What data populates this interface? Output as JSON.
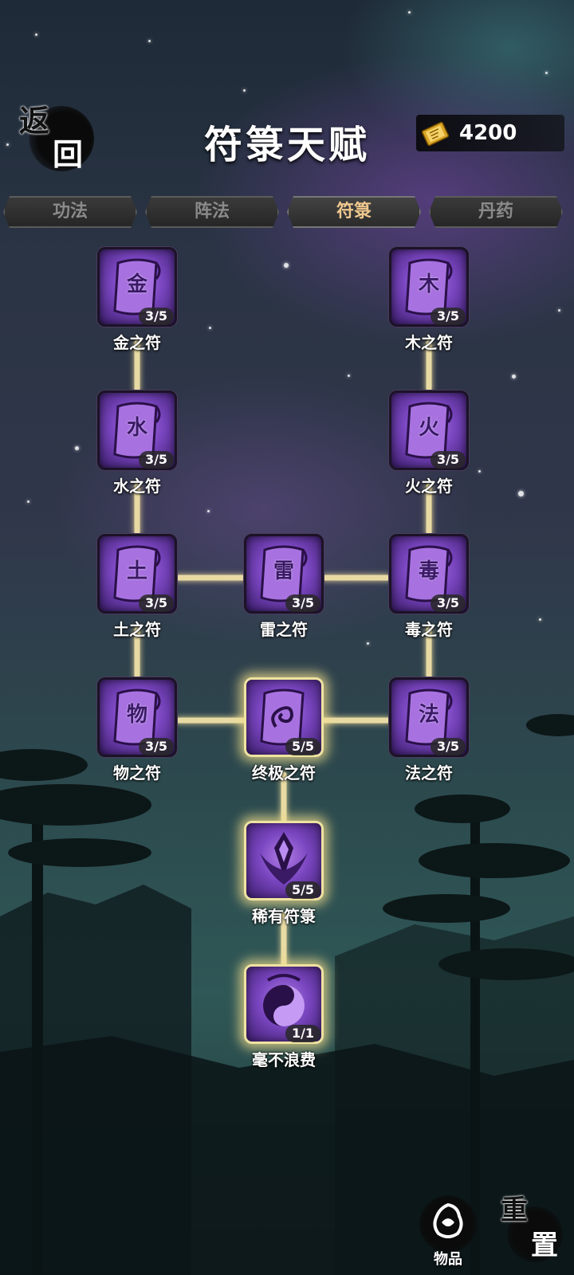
{
  "header": {
    "back_label_1": "返",
    "back_label_2": "回",
    "title": "符箓天赋",
    "currency_amount": "4200"
  },
  "tabs": [
    {
      "label": "功法",
      "active": false
    },
    {
      "label": "阵法",
      "active": false
    },
    {
      "label": "符箓",
      "active": true
    },
    {
      "label": "丹药",
      "active": false
    }
  ],
  "nodes": [
    {
      "id": "jin",
      "label": "金之符",
      "glyph": "金",
      "count": "3/5"
    },
    {
      "id": "mu",
      "label": "木之符",
      "glyph": "木",
      "count": "3/5"
    },
    {
      "id": "shui",
      "label": "水之符",
      "glyph": "水",
      "count": "3/5"
    },
    {
      "id": "huo",
      "label": "火之符",
      "glyph": "火",
      "count": "3/5"
    },
    {
      "id": "tu",
      "label": "土之符",
      "glyph": "土",
      "count": "3/5"
    },
    {
      "id": "lei",
      "label": "雷之符",
      "glyph": "雷",
      "count": "3/5"
    },
    {
      "id": "du",
      "label": "毒之符",
      "glyph": "毒",
      "count": "3/5"
    },
    {
      "id": "wu",
      "label": "物之符",
      "glyph": "物",
      "count": "3/5"
    },
    {
      "id": "zhongji",
      "label": "终极之符",
      "glyph": "",
      "count": "5/5"
    },
    {
      "id": "fa",
      "label": "法之符",
      "glyph": "法",
      "count": "3/5"
    },
    {
      "id": "xiyou",
      "label": "稀有符箓",
      "glyph": "",
      "count": "5/5"
    },
    {
      "id": "haobu",
      "label": "毫不浪费",
      "glyph": "",
      "count": "1/1"
    }
  ],
  "footer": {
    "items_label": "物品",
    "reset_label_1": "重",
    "reset_label_2": "置"
  },
  "colors": {
    "connector": "#f3e3a8",
    "node_purple": "#7a46c0",
    "active_tab_text": "#f0c88e"
  }
}
